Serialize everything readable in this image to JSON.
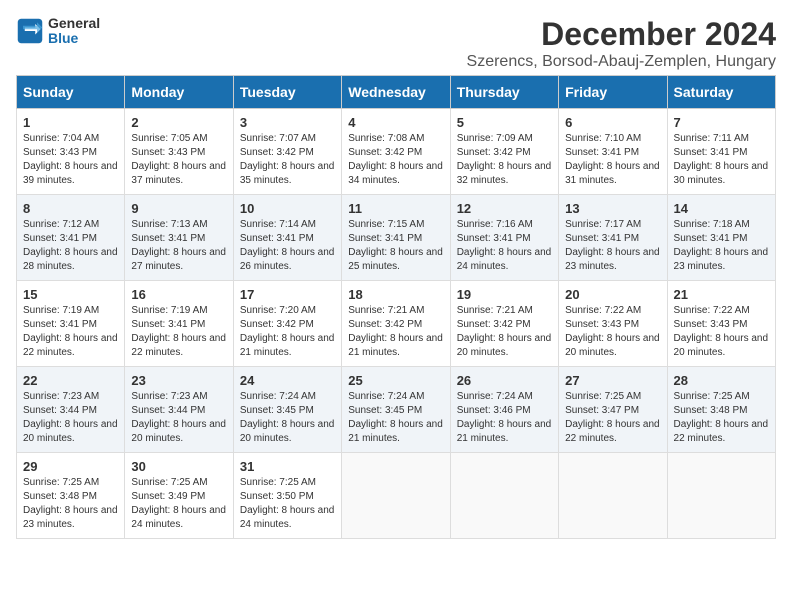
{
  "logo": {
    "line1": "General",
    "line2": "Blue"
  },
  "title": "December 2024",
  "subtitle": "Szerencs, Borsod-Abauj-Zemplen, Hungary",
  "headers": [
    "Sunday",
    "Monday",
    "Tuesday",
    "Wednesday",
    "Thursday",
    "Friday",
    "Saturday"
  ],
  "weeks": [
    [
      {
        "day": "1",
        "sunrise": "7:04 AM",
        "sunset": "3:43 PM",
        "daylight": "8 hours and 39 minutes."
      },
      {
        "day": "2",
        "sunrise": "7:05 AM",
        "sunset": "3:43 PM",
        "daylight": "8 hours and 37 minutes."
      },
      {
        "day": "3",
        "sunrise": "7:07 AM",
        "sunset": "3:42 PM",
        "daylight": "8 hours and 35 minutes."
      },
      {
        "day": "4",
        "sunrise": "7:08 AM",
        "sunset": "3:42 PM",
        "daylight": "8 hours and 34 minutes."
      },
      {
        "day": "5",
        "sunrise": "7:09 AM",
        "sunset": "3:42 PM",
        "daylight": "8 hours and 32 minutes."
      },
      {
        "day": "6",
        "sunrise": "7:10 AM",
        "sunset": "3:41 PM",
        "daylight": "8 hours and 31 minutes."
      },
      {
        "day": "7",
        "sunrise": "7:11 AM",
        "sunset": "3:41 PM",
        "daylight": "8 hours and 30 minutes."
      }
    ],
    [
      {
        "day": "8",
        "sunrise": "7:12 AM",
        "sunset": "3:41 PM",
        "daylight": "8 hours and 28 minutes."
      },
      {
        "day": "9",
        "sunrise": "7:13 AM",
        "sunset": "3:41 PM",
        "daylight": "8 hours and 27 minutes."
      },
      {
        "day": "10",
        "sunrise": "7:14 AM",
        "sunset": "3:41 PM",
        "daylight": "8 hours and 26 minutes."
      },
      {
        "day": "11",
        "sunrise": "7:15 AM",
        "sunset": "3:41 PM",
        "daylight": "8 hours and 25 minutes."
      },
      {
        "day": "12",
        "sunrise": "7:16 AM",
        "sunset": "3:41 PM",
        "daylight": "8 hours and 24 minutes."
      },
      {
        "day": "13",
        "sunrise": "7:17 AM",
        "sunset": "3:41 PM",
        "daylight": "8 hours and 23 minutes."
      },
      {
        "day": "14",
        "sunrise": "7:18 AM",
        "sunset": "3:41 PM",
        "daylight": "8 hours and 23 minutes."
      }
    ],
    [
      {
        "day": "15",
        "sunrise": "7:19 AM",
        "sunset": "3:41 PM",
        "daylight": "8 hours and 22 minutes."
      },
      {
        "day": "16",
        "sunrise": "7:19 AM",
        "sunset": "3:41 PM",
        "daylight": "8 hours and 22 minutes."
      },
      {
        "day": "17",
        "sunrise": "7:20 AM",
        "sunset": "3:42 PM",
        "daylight": "8 hours and 21 minutes."
      },
      {
        "day": "18",
        "sunrise": "7:21 AM",
        "sunset": "3:42 PM",
        "daylight": "8 hours and 21 minutes."
      },
      {
        "day": "19",
        "sunrise": "7:21 AM",
        "sunset": "3:42 PM",
        "daylight": "8 hours and 20 minutes."
      },
      {
        "day": "20",
        "sunrise": "7:22 AM",
        "sunset": "3:43 PM",
        "daylight": "8 hours and 20 minutes."
      },
      {
        "day": "21",
        "sunrise": "7:22 AM",
        "sunset": "3:43 PM",
        "daylight": "8 hours and 20 minutes."
      }
    ],
    [
      {
        "day": "22",
        "sunrise": "7:23 AM",
        "sunset": "3:44 PM",
        "daylight": "8 hours and 20 minutes."
      },
      {
        "day": "23",
        "sunrise": "7:23 AM",
        "sunset": "3:44 PM",
        "daylight": "8 hours and 20 minutes."
      },
      {
        "day": "24",
        "sunrise": "7:24 AM",
        "sunset": "3:45 PM",
        "daylight": "8 hours and 20 minutes."
      },
      {
        "day": "25",
        "sunrise": "7:24 AM",
        "sunset": "3:45 PM",
        "daylight": "8 hours and 21 minutes."
      },
      {
        "day": "26",
        "sunrise": "7:24 AM",
        "sunset": "3:46 PM",
        "daylight": "8 hours and 21 minutes."
      },
      {
        "day": "27",
        "sunrise": "7:25 AM",
        "sunset": "3:47 PM",
        "daylight": "8 hours and 22 minutes."
      },
      {
        "day": "28",
        "sunrise": "7:25 AM",
        "sunset": "3:48 PM",
        "daylight": "8 hours and 22 minutes."
      }
    ],
    [
      {
        "day": "29",
        "sunrise": "7:25 AM",
        "sunset": "3:48 PM",
        "daylight": "8 hours and 23 minutes."
      },
      {
        "day": "30",
        "sunrise": "7:25 AM",
        "sunset": "3:49 PM",
        "daylight": "8 hours and 24 minutes."
      },
      {
        "day": "31",
        "sunrise": "7:25 AM",
        "sunset": "3:50 PM",
        "daylight": "8 hours and 24 minutes."
      },
      null,
      null,
      null,
      null
    ]
  ]
}
